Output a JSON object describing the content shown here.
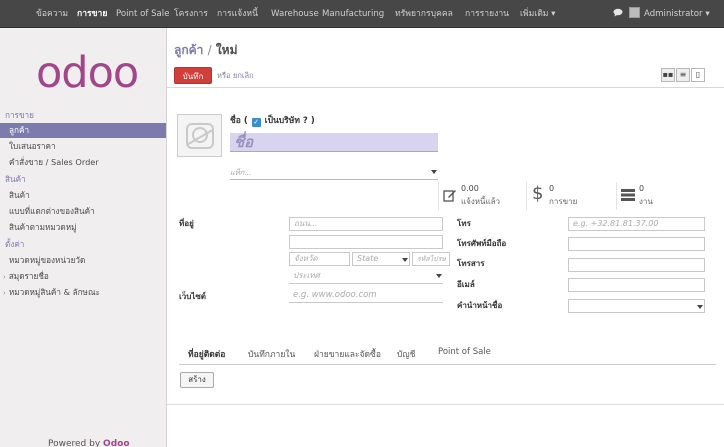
{
  "topbar": {
    "items": [
      "ข้อความ",
      "การขาย",
      "Point of Sale",
      "โครงการ",
      "การแจ้งหนี้",
      "Warehouse",
      "Manufacturing",
      "ทรัพยากรบุคคล",
      "การรายงาน",
      "เพิ่มเติม ▾"
    ],
    "chat_icon": "chat-bubble-icon",
    "user": "Administrator ▾"
  },
  "sidebar": {
    "logo": "odoo",
    "items": [
      {
        "label": "การขาย",
        "kind": "head"
      },
      {
        "label": "ลูกค้า",
        "kind": "selected"
      },
      {
        "label": "ใบเสนอราคา",
        "kind": "item"
      },
      {
        "label": "คำสั่งขาย / Sales Order",
        "kind": "item"
      },
      {
        "label": "สินค้า",
        "kind": "head"
      },
      {
        "label": "สินค้า",
        "kind": "item"
      },
      {
        "label": "แบบที่แตกต่างของสินค้า",
        "kind": "item"
      },
      {
        "label": "สินค้าตามหมวดหมู่",
        "kind": "item"
      },
      {
        "label": "ตั้งค่า",
        "kind": "head"
      },
      {
        "label": "หมวดหมู่ของหน่วยวัด",
        "kind": "item"
      },
      {
        "label": "สมุดรายชื่อ",
        "kind": "arrow"
      },
      {
        "label": "หมวดหมู่สินค้า & ลักษณะ",
        "kind": "arrow"
      }
    ],
    "powered_prefix": "Powered by",
    "powered_brand": "Odoo"
  },
  "control": {
    "crumb_parent": "ลูกค้า",
    "crumb_sep": "/",
    "crumb_current": "ใหม่",
    "save_label": "บันทึก",
    "or_text": "หรือ",
    "discard_label": "ยกเลิก",
    "view_kanban": "▪▪",
    "view_list": "≡",
    "view_form": "▯"
  },
  "form": {
    "name_label": "ชื่อ",
    "is_company_label": "เป็นบริษัท ?",
    "is_company_checked": true,
    "name_placeholder": "ชื่อ",
    "title_placeholder": "แท็ก...",
    "stats": [
      {
        "icon": "edit-icon",
        "value": "0.00",
        "label": "แจ้งหนี้แล้ว"
      },
      {
        "icon": "dollar-icon",
        "value": "0",
        "label": "การขาย"
      },
      {
        "icon": "tasks-icon",
        "value": "0",
        "label": "งาน"
      }
    ],
    "address_label": "ที่อยู่",
    "street_placeholder": "ถนน...",
    "street2_placeholder": "",
    "city_placeholder": "จังหวัด",
    "state_placeholder": "State",
    "zip_placeholder": "รหัสไปรษ",
    "country_placeholder": "ประเทศ",
    "website_label": "เว็บไซต์",
    "website_placeholder": "e.g. www.odoo.com",
    "phone_label": "โทร",
    "phone_placeholder": "e.g. +32.81.81.37.00",
    "mobile_label": "โทรศัพท์มือถือ",
    "fax_label": "โทรสาร",
    "email_label": "อีเมล์",
    "title_label": "คำนำหน้าชื่อ"
  },
  "tabs": [
    "ที่อยู่ติดต่อ",
    "บันทึกภายใน",
    "ฝ่ายขายและจัดซื้อ",
    "บัญชี",
    "Point of Sale"
  ],
  "create_label": "สร้าง"
}
